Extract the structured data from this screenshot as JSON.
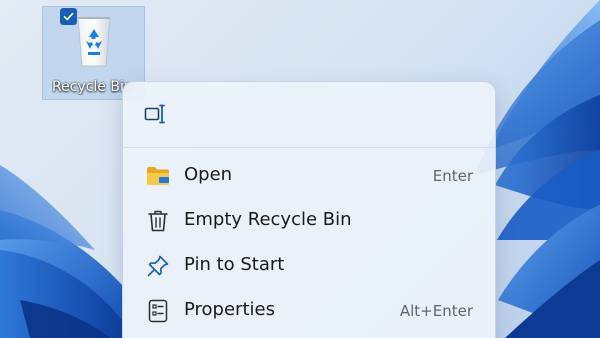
{
  "desktop": {
    "recycle_bin": {
      "label": "Recycle Bin",
      "icon": "recycle-bin-icon",
      "selected": true
    }
  },
  "context_menu": {
    "toolbar": {
      "rename_icon": "rename-icon"
    },
    "items": [
      {
        "label": "Open",
        "shortcut": "Enter",
        "icon": "folder-icon"
      },
      {
        "label": "Empty Recycle Bin",
        "shortcut": "",
        "icon": "trash-icon"
      },
      {
        "label": "Pin to Start",
        "shortcut": "",
        "icon": "pin-icon"
      },
      {
        "label": "Properties",
        "shortcut": "Alt+Enter",
        "icon": "properties-icon"
      }
    ]
  },
  "colors": {
    "accent": "#1a5fb4",
    "wallpaper_blue": "#1f6fd1",
    "menu_background": "#ecf2fa",
    "folder_yellow": "#f4c13d"
  }
}
